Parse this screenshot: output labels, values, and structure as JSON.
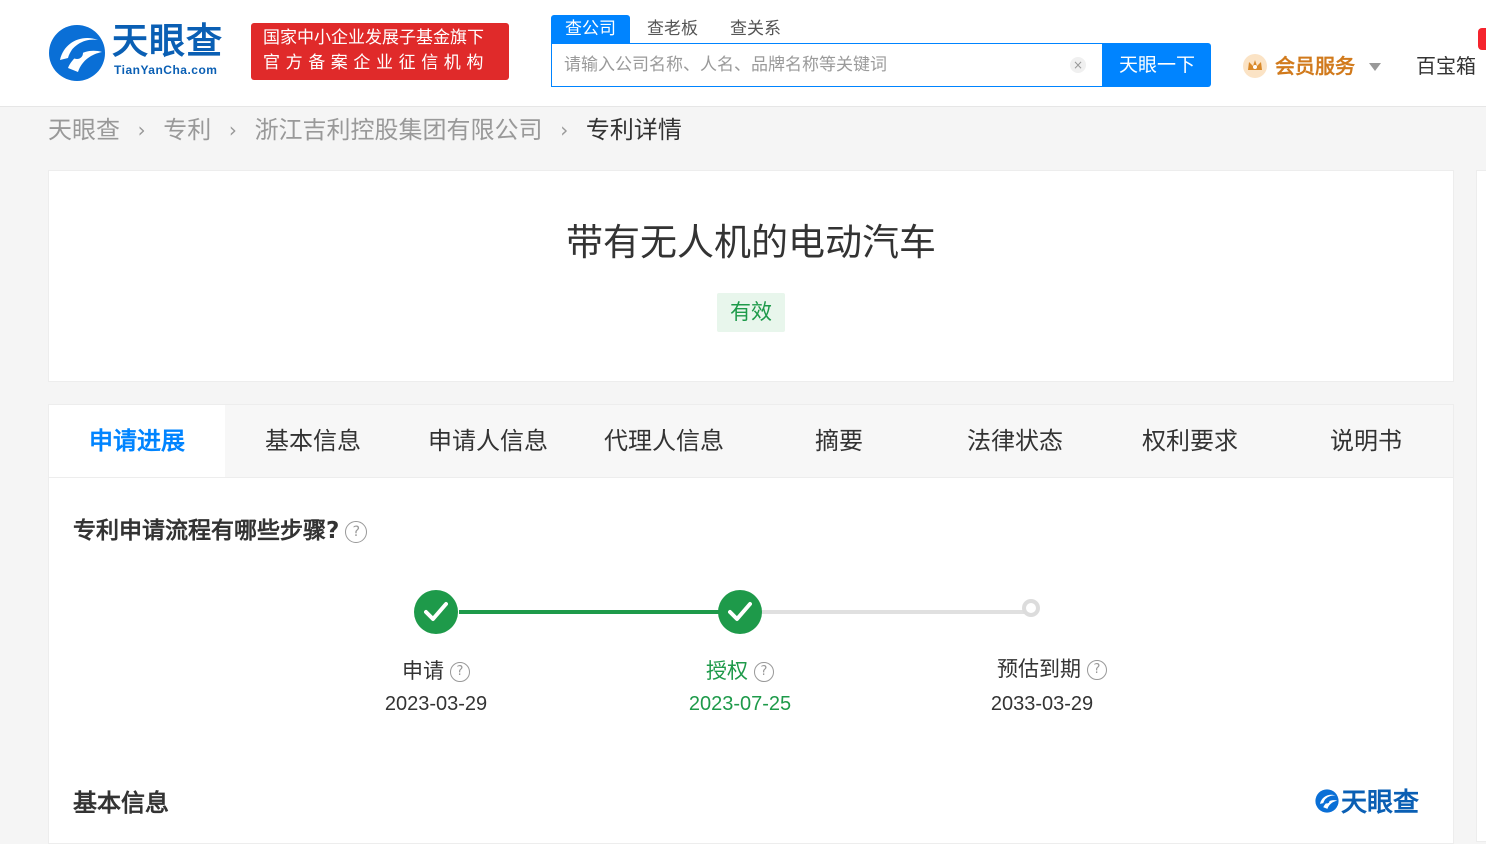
{
  "header": {
    "logo_cn": "天眼查",
    "logo_en": "TianYanCha.com",
    "gov_badge_line1": "国家中小企业发展子基金旗下",
    "gov_badge_line2": "官方备案企业征信机构",
    "search_tabs": [
      "查公司",
      "查老板",
      "查关系"
    ],
    "search_placeholder": "请输入公司名称、人名、品牌名称等关键词",
    "search_value": "",
    "clear_symbol": "×",
    "search_button": "天眼一下",
    "vip_label": "会员服务",
    "toolbox_label": "百宝箱"
  },
  "breadcrumb": {
    "items": [
      "天眼查",
      "专利",
      "浙江吉利控股集团有限公司"
    ],
    "current": "专利详情",
    "separator": "›"
  },
  "patent": {
    "title": "带有无人机的电动汽车",
    "status": "有效"
  },
  "tabs": [
    "申请进展",
    "基本信息",
    "申请人信息",
    "代理人信息",
    "摘要",
    "法律状态",
    "权利要求",
    "说明书"
  ],
  "progress": {
    "section_title": "专利申请流程有哪些步骤?",
    "steps": [
      {
        "label": "申请",
        "date": "2023-03-29",
        "state": "done"
      },
      {
        "label": "授权",
        "date": "2023-07-25",
        "state": "done"
      },
      {
        "label": "预估到期",
        "date": "2033-03-29",
        "state": "pending"
      }
    ]
  },
  "basic_info": {
    "title": "基本信息",
    "watermark": "天眼查"
  },
  "colors": {
    "brand_blue": "#0084ff",
    "success_green": "#1e9a4a",
    "gov_red": "#e02a2a",
    "vip_orange": "#d17a1c"
  },
  "icons": [
    "logo-icon",
    "clear-icon",
    "crown-icon",
    "caret-down-icon",
    "question-icon",
    "check-icon"
  ]
}
